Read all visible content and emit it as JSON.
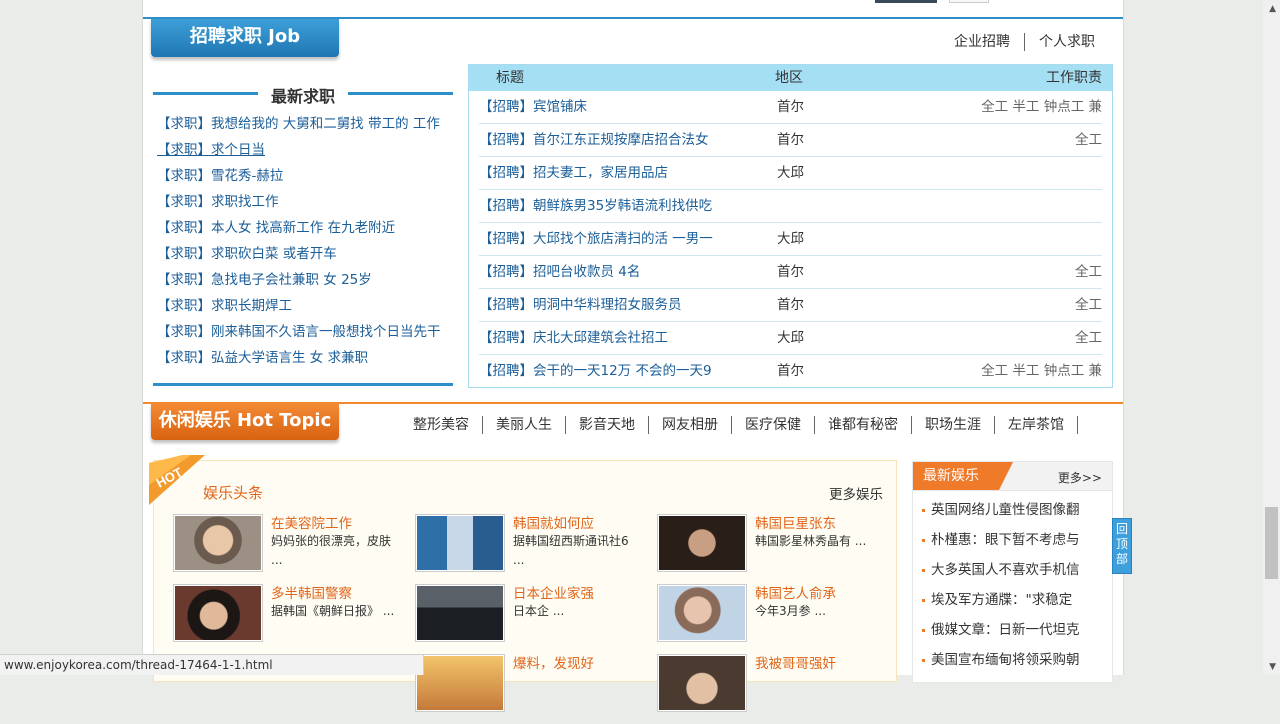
{
  "job": {
    "tab_title": "招聘求职 Job",
    "links": [
      "企业招聘",
      "个人求职"
    ],
    "seek_heading": "最新求职",
    "seek_items": [
      {
        "tag": "【求职】",
        "text": "我想给我的 大舅和二舅找 带工的 工作"
      },
      {
        "tag": "【求职】",
        "text": "求个日当"
      },
      {
        "tag": "【求职】",
        "text": "雪花秀-赫拉"
      },
      {
        "tag": "【求职】",
        "text": "求职找工作"
      },
      {
        "tag": "【求职】",
        "text": "本人女 找高新工作 在九老附近"
      },
      {
        "tag": "【求职】",
        "text": "求职砍白菜 或者开车"
      },
      {
        "tag": "【求职】",
        "text": "急找电子会社兼职 女 25岁"
      },
      {
        "tag": "【求职】",
        "text": "求职长期焊工"
      },
      {
        "tag": "【求职】",
        "text": "刚来韩国不久语言一般想找个日当先干"
      },
      {
        "tag": "【求职】",
        "text": "弘益大学语言生 女 求兼职"
      }
    ],
    "table_headers": {
      "title": "标题",
      "region": "地区",
      "type": "工作职责"
    },
    "posts": [
      {
        "title": "【招聘】宾馆铺床",
        "region": "首尔",
        "type": "全工 半工 钟点工 兼"
      },
      {
        "title": "【招聘】首尔江东正规按摩店招合法女",
        "region": "首尔",
        "type": "全工"
      },
      {
        "title": "【招聘】招夫妻工，家居用品店",
        "region": "大邱",
        "type": ""
      },
      {
        "title": "【招聘】朝鲜族男35岁韩语流利找供吃",
        "region": "",
        "type": ""
      },
      {
        "title": "【招聘】大邱找个旅店清扫的活 一男一",
        "region": "大邱",
        "type": ""
      },
      {
        "title": "【招聘】招吧台收款员 4名",
        "region": "首尔",
        "type": "全工"
      },
      {
        "title": "【招聘】明洞中华料理招女服务员",
        "region": "首尔",
        "type": "全工"
      },
      {
        "title": "【招聘】庆北大邱建筑会社招工",
        "region": "大邱",
        "type": "全工"
      },
      {
        "title": "【招聘】会干的一天12万 不会的一天9",
        "region": "首尔",
        "type": "全工 半工 钟点工 兼"
      }
    ]
  },
  "hot": {
    "tab_title": "休闲娱乐 Hot Topic",
    "nav": [
      "整形美容",
      "美丽人生",
      "影音天地",
      "网友相册",
      "医疗保健",
      "谁都有秘密",
      "职场生涯",
      "左岸茶馆"
    ],
    "badge": "HOT",
    "ent_title": "娱乐头条",
    "ent_more": "更多娱乐",
    "news": [
      {
        "title": "在美容院工作",
        "desc": "妈妈张的很漂亮，皮肤 ..."
      },
      {
        "title": "韩国就如何应",
        "desc": "据韩国纽西斯通讯社6 ..."
      },
      {
        "title": "韩国巨星张东",
        "desc": "韩国影星林秀晶有 ..."
      },
      {
        "title": "多半韩国警察",
        "desc": "据韩国《朝鲜日报》 ..."
      },
      {
        "title": "日本企业家强",
        "desc": "日本企 ..."
      },
      {
        "title": "韩国艺人俞承",
        "desc": "今年3月参 ..."
      },
      {
        "title": "",
        "desc": ""
      },
      {
        "title": "爆料，发现好",
        "desc": ""
      },
      {
        "title": "我被哥哥强奸",
        "desc": ""
      }
    ],
    "latest_title": "最新娱乐",
    "latest_more": "更多>>",
    "latest": [
      "英国网络儿童性侵图像翻",
      "朴槿惠：眼下暂不考虑与",
      "大多英国人不喜欢手机信",
      "埃及军方通牒：\"求稳定",
      "俄媒文章：日新一代坦克",
      "美国宣布缅甸将领采购朝"
    ]
  },
  "backtop": "回顶部",
  "status_url": "www.enjoykorea.com/thread-17464-1-1.html"
}
